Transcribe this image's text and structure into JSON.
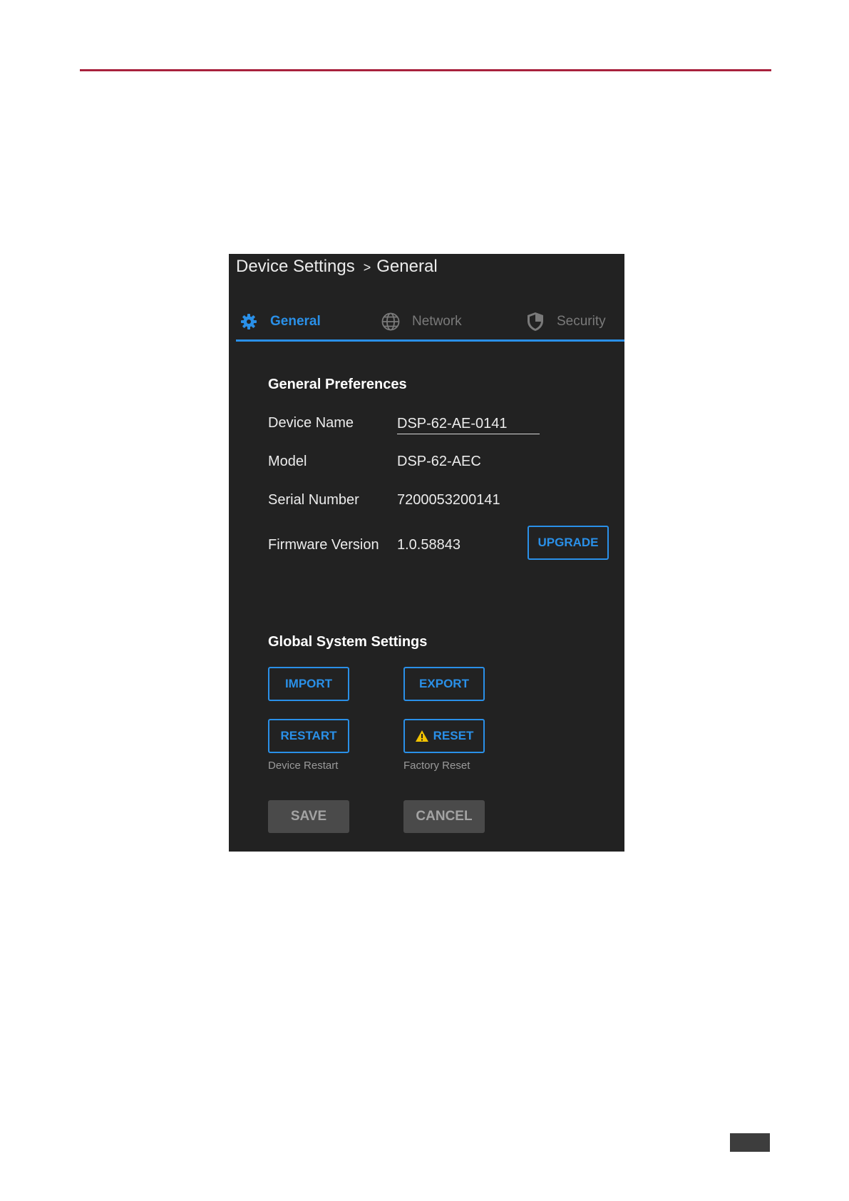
{
  "breadcrumb": {
    "parent": "Device Settings",
    "separator": ">",
    "current": "General"
  },
  "tabs": [
    {
      "label": "General",
      "icon": "gear-icon",
      "active": true
    },
    {
      "label": "Network",
      "icon": "globe-icon",
      "active": false
    },
    {
      "label": "Security",
      "icon": "shield-icon",
      "active": false
    }
  ],
  "general_preferences": {
    "title": "General Preferences",
    "device_name_label": "Device Name",
    "device_name_value": "DSP-62-AE-0141",
    "model_label": "Model",
    "model_value": "DSP-62-AEC",
    "serial_label": "Serial Number",
    "serial_value": "7200053200141",
    "firmware_label": "Firmware Version",
    "firmware_value": "1.0.58843",
    "upgrade_label": "UPGRADE"
  },
  "global_settings": {
    "title": "Global System Settings",
    "import_label": "IMPORT",
    "export_label": "EXPORT",
    "restart_label": "RESTART",
    "restart_caption": "Device Restart",
    "reset_label": "RESET",
    "reset_caption": "Factory Reset"
  },
  "actions": {
    "save_label": "SAVE",
    "cancel_label": "CANCEL"
  },
  "colors": {
    "accent": "#2a90e8",
    "panel_bg": "#222222",
    "rule": "#a8213d",
    "warning": "#f2c300"
  }
}
